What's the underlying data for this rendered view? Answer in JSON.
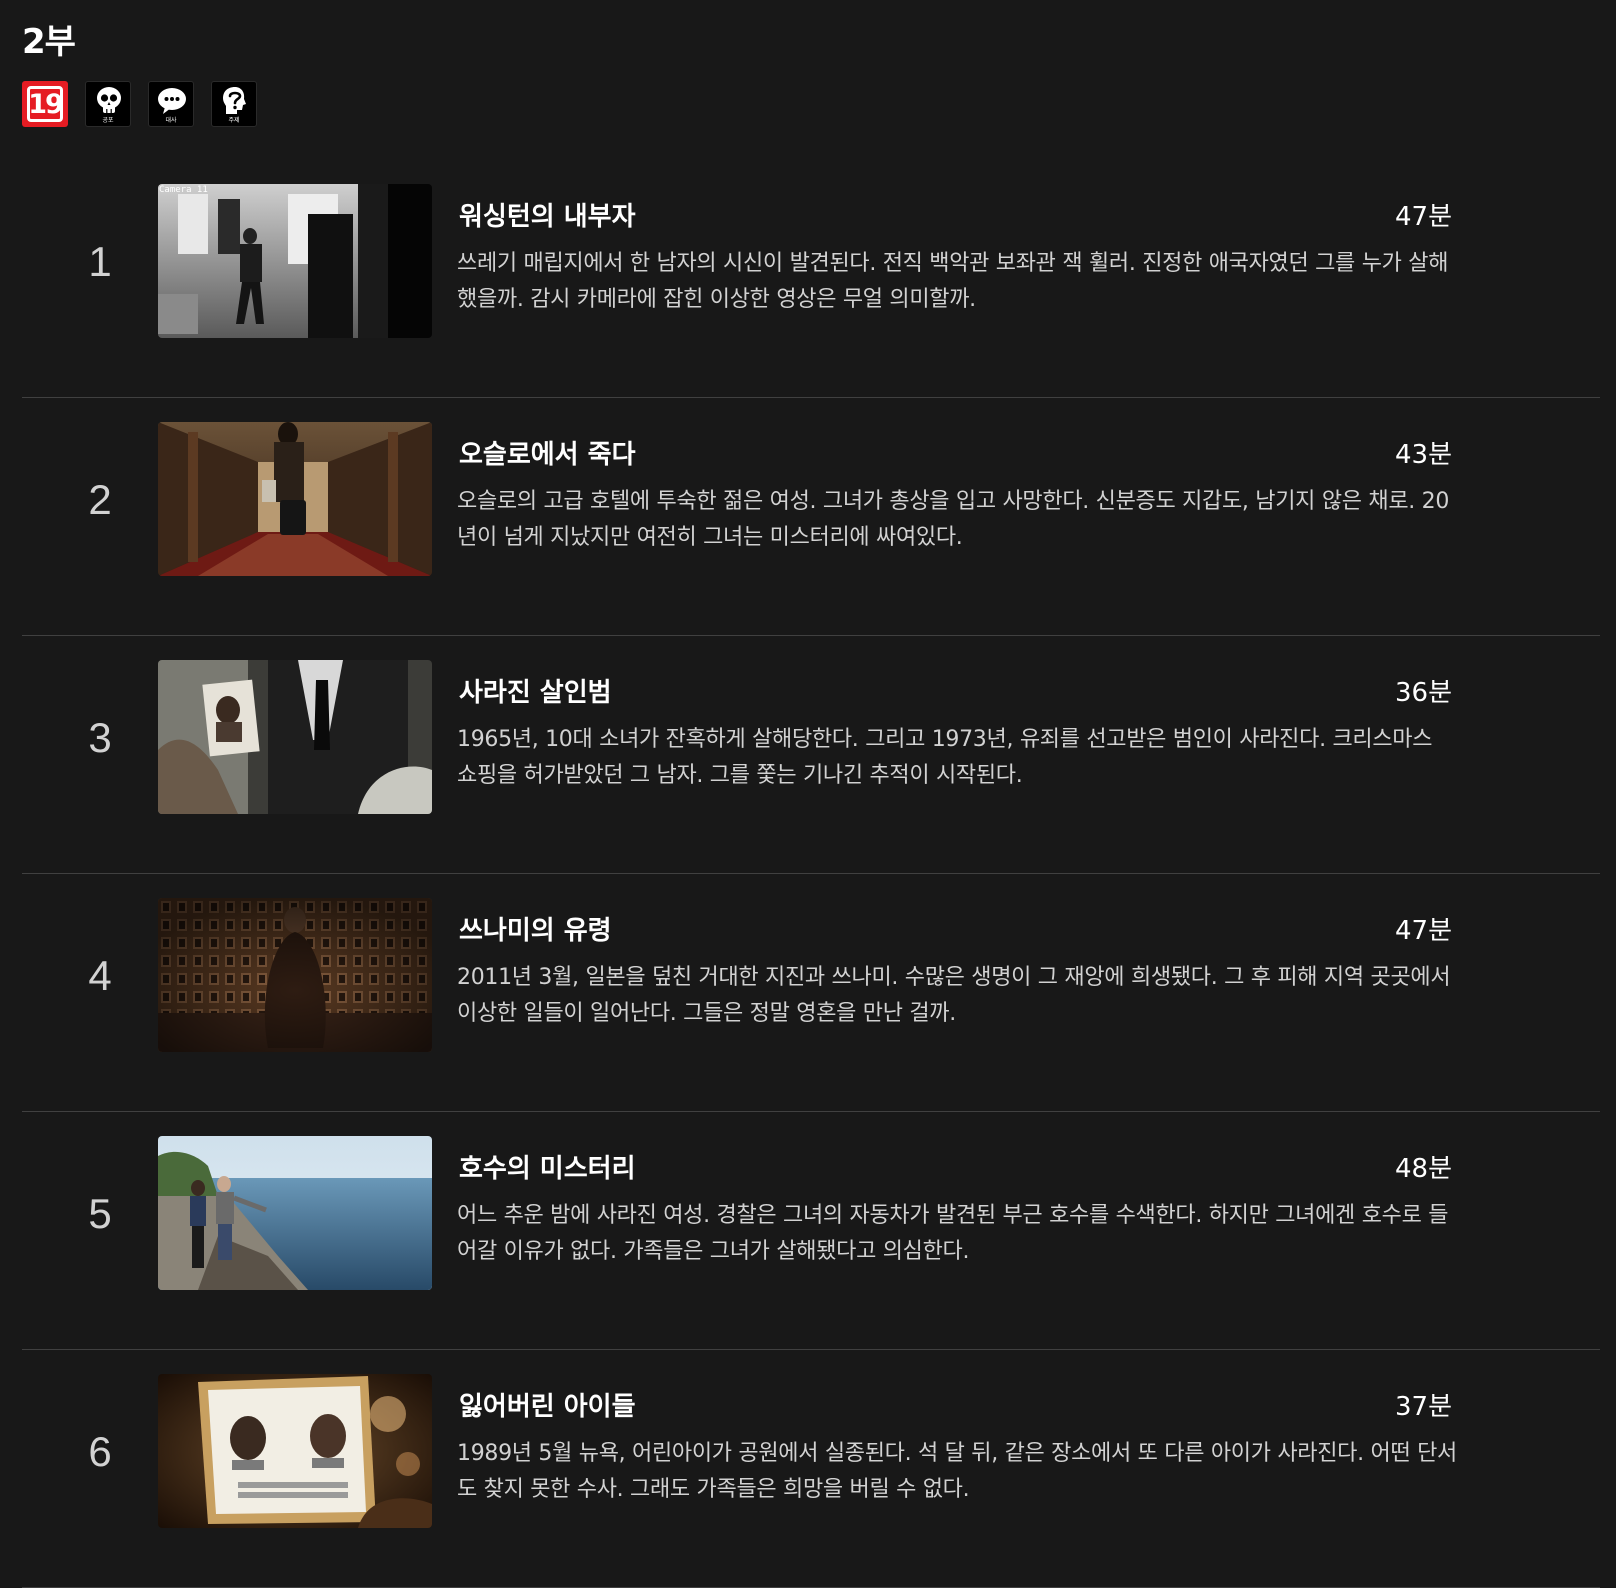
{
  "season": {
    "title": "2부"
  },
  "badges": {
    "age": "19",
    "horror": "공포",
    "dialogue": "대사",
    "theme": "주제"
  },
  "episodes": [
    {
      "number": "1",
      "title": "워싱턴의 내부자",
      "duration": "47분",
      "synopsis": "쓰레기 매립지에서 한 남자의 시신이 발견된다. 전직 백악관 보좌관 잭 휠러. 진정한 애국자였던 그를 누가 살해했을까. 감시 카메라에 잡힌 이상한 영상은 무얼 의미할까.",
      "thumb_caption": "Camera 11"
    },
    {
      "number": "2",
      "title": "오슬로에서 죽다",
      "duration": "43분",
      "synopsis": "오슬로의 고급 호텔에 투숙한 젊은 여성. 그녀가 총상을 입고 사망한다. 신분증도 지갑도, 남기지 않은 채로. 20년이 넘게 지났지만 여전히 그녀는 미스터리에 싸여있다."
    },
    {
      "number": "3",
      "title": "사라진 살인범",
      "duration": "36분",
      "synopsis": "1965년, 10대 소녀가 잔혹하게 살해당한다. 그리고 1973년, 유죄를 선고받은 범인이 사라진다. 크리스마스 쇼핑을 허가받았던 그 남자. 그를 쫓는 기나긴 추적이 시작된다."
    },
    {
      "number": "4",
      "title": "쓰나미의 유령",
      "duration": "47분",
      "synopsis": "2011년 3월, 일본을 덮친 거대한 지진과 쓰나미. 수많은 생명이 그 재앙에 희생됐다. 그 후 피해 지역 곳곳에서 이상한 일들이 일어난다. 그들은 정말 영혼을 만난 걸까."
    },
    {
      "number": "5",
      "title": "호수의 미스터리",
      "duration": "48분",
      "synopsis": "어느 추운 밤에 사라진 여성. 경찰은 그녀의 자동차가 발견된 부근 호수를 수색한다. 하지만 그녀에겐 호수로 들어갈 이유가 없다. 가족들은 그녀가 살해됐다고 의심한다."
    },
    {
      "number": "6",
      "title": "잃어버린 아이들",
      "duration": "37분",
      "synopsis": "1989년 5월 뉴욕, 어린아이가 공원에서 실종된다. 석 달 뒤, 같은 장소에서 또 다른 아이가 사라진다. 어떤 단서도 찾지 못한 수사. 그래도 가족들은 희망을 버릴 수 없다."
    }
  ]
}
